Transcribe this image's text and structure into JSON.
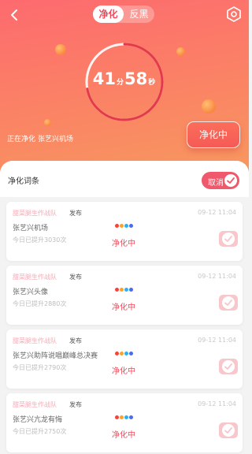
{
  "header": {
    "tabs": [
      {
        "label": "净化",
        "active": true
      },
      {
        "label": "反黑",
        "active": false
      }
    ]
  },
  "timer": {
    "minutes": "41",
    "minutes_unit": "分",
    "seconds": "58",
    "seconds_unit": "秒",
    "progress": 0.72
  },
  "status": {
    "prefix": "正在净化",
    "target": "张艺兴机场"
  },
  "action_button": {
    "label": "净化中"
  },
  "sheet": {
    "title": "净化词条",
    "cancel_label": "取消"
  },
  "items": [
    {
      "team": "甜菜腿生作战队",
      "publish": "发布",
      "date": "09-12 11:04",
      "keyword": "张艺兴机场",
      "today": "今日已提升3030次",
      "state": "净化中"
    },
    {
      "team": "甜菜腿生作战队",
      "publish": "发布",
      "date": "09-12 11:04",
      "keyword": "张艺兴头像",
      "today": "今日已提升2880次",
      "state": "净化中"
    },
    {
      "team": "甜菜腿生作战队",
      "publish": "发布",
      "date": "09-12 11:04",
      "keyword": "张艺兴助阵说唱巅峰总决赛",
      "today": "今日已提升2790次",
      "state": "净化中"
    },
    {
      "team": "甜菜腿生作战队",
      "publish": "发布",
      "date": "09-12 11:04",
      "keyword": "张艺兴亢龙有悔",
      "today": "今日已提升2750次",
      "state": "净化中"
    }
  ],
  "colors": {
    "accent": "#ee4b5b",
    "dots": [
      "#f7413c",
      "#f9a32b",
      "#2bb1ef",
      "#4a6bf0"
    ]
  }
}
